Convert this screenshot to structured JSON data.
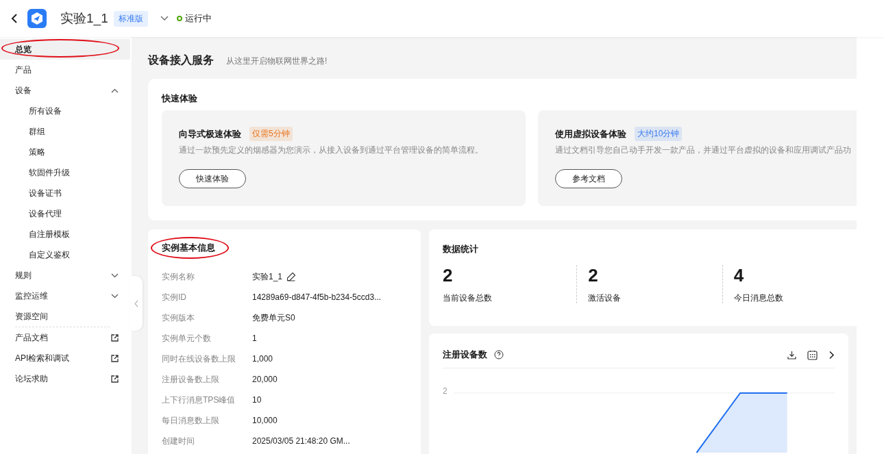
{
  "header": {
    "instance_name": "实验1_1",
    "edition_badge": "标准版",
    "status": {
      "text": "运行中",
      "color": "#52a80a"
    }
  },
  "sidebar": {
    "items": [
      {
        "label": "总览",
        "kind": "plain",
        "selected": true,
        "annotated": true
      },
      {
        "label": "产品",
        "kind": "plain",
        "selected": false
      },
      {
        "label": "设备",
        "kind": "group",
        "selected": false,
        "expanded": true,
        "children": [
          {
            "label": "所有设备",
            "selected": false
          },
          {
            "label": "群组",
            "selected": false
          },
          {
            "label": "策略",
            "selected": false
          },
          {
            "label": "软固件升级",
            "selected": false
          },
          {
            "label": "设备证书",
            "selected": false
          },
          {
            "label": "设备代理",
            "selected": false
          },
          {
            "label": "自注册模板",
            "selected": false
          },
          {
            "label": "自定义鉴权",
            "selected": false
          }
        ]
      },
      {
        "label": "规则",
        "kind": "group",
        "selected": false,
        "expanded": false
      },
      {
        "label": "监控运维",
        "kind": "group",
        "selected": false,
        "expanded": false
      },
      {
        "label": "资源空间",
        "kind": "plain",
        "selected": false,
        "divider_after": true
      },
      {
        "label": "产品文档",
        "kind": "external",
        "selected": false
      },
      {
        "label": "API检索和调试",
        "kind": "external",
        "selected": false
      },
      {
        "label": "论坛求助",
        "kind": "external",
        "selected": false
      }
    ]
  },
  "page": {
    "title": "设备接入服务",
    "subtitle": "从这里开启物联网世界之路!"
  },
  "quick_start": {
    "title": "快速体验",
    "cards": [
      {
        "title": "向导式极速体验",
        "tag": "仅需5分钟",
        "color": "#e8761e",
        "description": "通过一款预先定义的烟感器为您演示，从接入设备到通过平台管理设备的简单流程。",
        "button": "快速体验"
      },
      {
        "title": "使用虚拟设备体验",
        "tag": "大约10分钟",
        "color": "#3b7cf0",
        "description": "通过文档引导您自己动手开发一款产品，并通过平台虚拟的设备和应用调试产品功",
        "button": "参考文档"
      }
    ]
  },
  "instance_info": {
    "title": "实例基本信息",
    "annotated": true,
    "rows": [
      {
        "label": "实例名称",
        "value": "实验1_1",
        "editable": true
      },
      {
        "label": "实例ID",
        "value": "14289a69-d847-4f5b-b234-5ccd3..."
      },
      {
        "label": "实例版本",
        "value": "免费单元S0"
      },
      {
        "label": "实例单元个数",
        "value": "1"
      },
      {
        "label": "同时在线设备数上限",
        "value": "1,000"
      },
      {
        "label": "注册设备数上限",
        "value": "20,000"
      },
      {
        "label": "上下行消息TPS峰值",
        "value": "10"
      },
      {
        "label": "每日消息数上限",
        "value": "10,000"
      },
      {
        "label": "创建时间",
        "value": "2025/03/05 21:48:20 GM..."
      }
    ]
  },
  "statistics": {
    "title": "数据统计",
    "items": [
      {
        "value": "2",
        "label": "当前设备总数"
      },
      {
        "value": "2",
        "label": "激活设备"
      },
      {
        "value": "4",
        "label": "今日消息总数"
      }
    ]
  },
  "registered_devices_chart": {
    "title": "注册设备数",
    "axis_label": "2"
  }
}
